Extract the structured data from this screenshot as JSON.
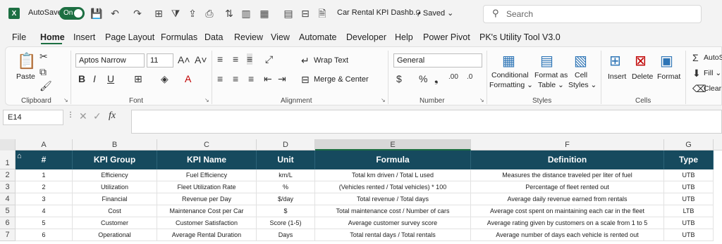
{
  "titlebar": {
    "autosave_label": "AutoSave",
    "autosave_state": "On",
    "doc_title": "Car Rental KPI Dashb...",
    "saved_status": "• Saved ⌄",
    "search_placeholder": "Search"
  },
  "menu": [
    "File",
    "Home",
    "Insert",
    "Page Layout",
    "Formulas",
    "Data",
    "Review",
    "View",
    "Automate",
    "Developer",
    "Help",
    "Power Pivot",
    "PK's Utility Tool V3.0"
  ],
  "ribbon": {
    "clipboard": {
      "paste": "Paste",
      "label": "Clipboard"
    },
    "font": {
      "name": "Aptos Narrow",
      "size": "11",
      "label": "Font"
    },
    "alignment": {
      "wrap": "Wrap Text",
      "merge": "Merge & Center",
      "label": "Alignment"
    },
    "number": {
      "format": "General",
      "label": "Number"
    },
    "styles": {
      "cond1": "Conditional",
      "cond2": "Formatting ⌄",
      "fmt1": "Format as",
      "fmt2": "Table ⌄",
      "cell1": "Cell",
      "cell2": "Styles ⌄",
      "label": "Styles"
    },
    "cells": {
      "insert": "Insert",
      "delete": "Delete",
      "format": "Format",
      "label": "Cells"
    },
    "editing": {
      "autosum": "AutoS",
      "fill": "Fill ⌄",
      "clear": "Clear"
    }
  },
  "formula_bar": {
    "name_box": "E14",
    "fx": "fx"
  },
  "columns": [
    "A",
    "B",
    "C",
    "D",
    "E",
    "F",
    "G"
  ],
  "rows": [
    "1",
    "2",
    "3",
    "4",
    "5",
    "6",
    "7"
  ],
  "table": {
    "headers": [
      "#",
      "KPI Group",
      "KPI Name",
      "Unit",
      "Formula",
      "Definition",
      "Type"
    ],
    "rows": [
      [
        "1",
        "Efficiency",
        "Fuel Efficiency",
        "km/L",
        "Total km driven / Total L used",
        "Measures the distance traveled per liter of fuel",
        "UTB"
      ],
      [
        "2",
        "Utilization",
        "Fleet Utilization Rate",
        "%",
        "(Vehicles rented / Total vehicles) * 100",
        "Percentage of fleet rented out",
        "UTB"
      ],
      [
        "3",
        "Financial",
        "Revenue per Day",
        "$/day",
        "Total revenue / Total days",
        "Average daily revenue earned from rentals",
        "UTB"
      ],
      [
        "4",
        "Cost",
        "Maintenance Cost per Car",
        "$",
        "Total maintenance cost / Number of cars",
        "Average cost spent on maintaining each car in the fleet",
        "LTB"
      ],
      [
        "5",
        "Customer",
        "Customer Satisfaction",
        "Score (1-5)",
        "Average customer survey score",
        "Average rating given by customers on a scale from 1 to 5",
        "UTB"
      ],
      [
        "6",
        "Operational",
        "Average Rental Duration",
        "Days",
        "Total rental days / Total rentals",
        "Average number of days each vehicle is rented out",
        "UTB"
      ]
    ]
  },
  "colors": {
    "header_bg": "#164a5e",
    "excel_green": "#1d6f42"
  }
}
